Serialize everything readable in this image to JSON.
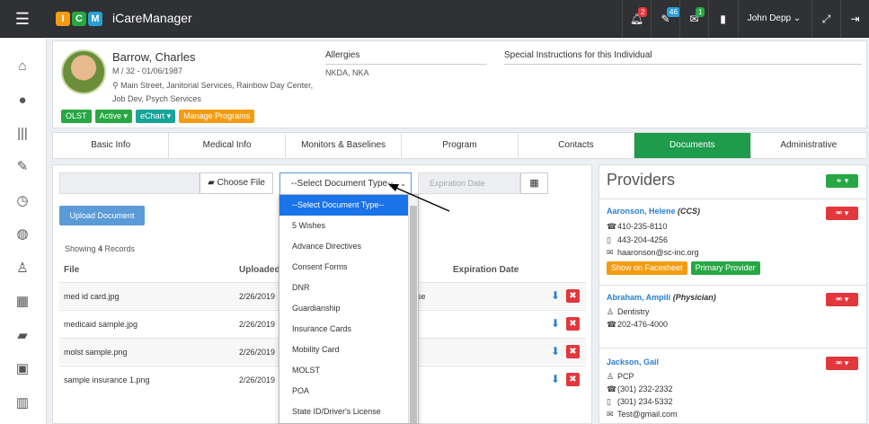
{
  "header": {
    "menu_icon": "hamburger-icon",
    "logo_letters": [
      "I",
      "C",
      "M"
    ],
    "logo_colors": [
      "#f39c12",
      "#28a745",
      "#2a9fd6"
    ],
    "app_name": "iCareManager",
    "notifications_count": "2",
    "tasks_count": "46",
    "messages_count": "1",
    "user_name": "John Depp ⌄"
  },
  "patient": {
    "name": "Barrow, Charles",
    "meta": "M / 32 - 01/06/1987",
    "address": "Main Street, Janitorial Services, Rainbow Day Center, Job Dev, Psych Services",
    "buttons": {
      "olst": "OLST",
      "active": "Active",
      "echart": "eChart",
      "programs": "Manage Programs"
    },
    "allergies_label": "Allergies",
    "allergies_value": "NKDA, NKA",
    "special_label": "Special Instructions for this Individual"
  },
  "tabs": [
    "Basic Info",
    "Medical Info",
    "Monitors & Baselines",
    "Program",
    "Contacts",
    "Documents",
    "Administrative"
  ],
  "documents": {
    "choose_file": "Choose File",
    "doc_type_selected": "--Select Document Type--",
    "expiration_placeholder": "Expiration Date",
    "upload_label": "Upload Document",
    "showing_prefix": "Showing ",
    "showing_count": "4",
    "showing_suffix": " Records",
    "col_file": "File",
    "col_uploaded": "Uploaded",
    "col_expiration": "Expiration Date",
    "rows": [
      {
        "file": "med id card.jpg",
        "date": "2/26/2019",
        "extra": "se"
      },
      {
        "file": "medicaid sample.jpg",
        "date": "2/26/2019",
        "extra": ""
      },
      {
        "file": "molst sample.png",
        "date": "2/26/2019",
        "extra": ""
      },
      {
        "file": "sample insurance 1.png",
        "date": "2/26/2019",
        "extra": ""
      }
    ],
    "dropdown_options": [
      "--Select Document Type--",
      "5 Wishes",
      "Advance Directives",
      "Consent Forms",
      "DNR",
      "Guardianship",
      "Insurance Cards",
      "Mobility Card",
      "MOLST",
      "POA",
      "State ID/Driver's License"
    ]
  },
  "providers": {
    "title": "Providers",
    "list": [
      {
        "name": "Aaronson, Helene",
        "role": "(CCS)",
        "phone1": "410-235-8110",
        "phone2": "443-204-4256",
        "email": "haaronson@sc-inc.org",
        "btn1": "Show on Facesheet",
        "btn2": "Primary Provider"
      },
      {
        "name": "Abraham, Ampili",
        "role": "(Physician)",
        "specialty": "Dentistry",
        "phone1": "202-476-4000"
      },
      {
        "name": "Jackson, Gail",
        "specialty": "PCP",
        "phone1": "(301) 232-2332",
        "phone2": "(301) 234-5332",
        "email": "Test@gmail.com"
      }
    ]
  }
}
